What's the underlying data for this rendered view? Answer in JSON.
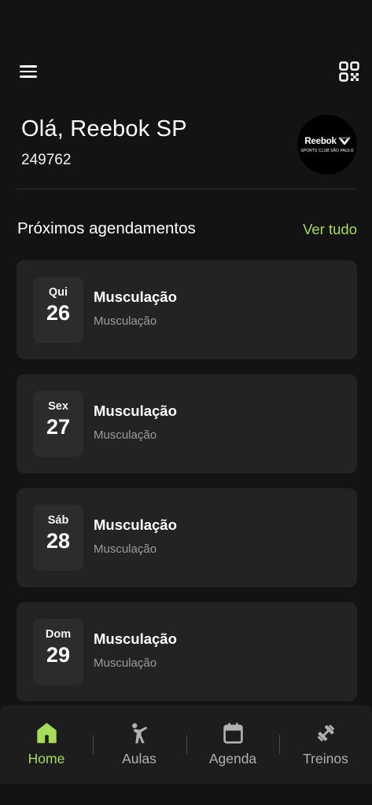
{
  "header": {
    "greeting": "Olá, Reebok SP",
    "member_id": "249762",
    "logo": {
      "brand": "Reebok",
      "subtitle": "SPORTS CLUB SÃO PAULO"
    },
    "icons": {
      "menu": "menu-icon",
      "qr": "qr-code-icon"
    }
  },
  "section": {
    "title": "Próximos agendamentos",
    "see_all": "Ver tudo"
  },
  "appointments": [
    {
      "day": "Qui",
      "date": "26",
      "title": "Musculação",
      "subtitle": "Musculação"
    },
    {
      "day": "Sex",
      "date": "27",
      "title": "Musculação",
      "subtitle": "Musculação"
    },
    {
      "day": "Sáb",
      "date": "28",
      "title": "Musculação",
      "subtitle": "Musculação"
    },
    {
      "day": "Dom",
      "date": "29",
      "title": "Musculação",
      "subtitle": "Musculação"
    }
  ],
  "nav": {
    "items": [
      {
        "label": "Home",
        "icon": "home-icon",
        "active": true
      },
      {
        "label": "Aulas",
        "icon": "person-exercise-icon",
        "active": false
      },
      {
        "label": "Agenda",
        "icon": "calendar-icon",
        "active": false
      },
      {
        "label": "Treinos",
        "icon": "dumbbell-icon",
        "active": false
      }
    ]
  },
  "colors": {
    "background": "#131313",
    "card": "#232323",
    "date_box": "#2c2c2c",
    "accent": "#a6dc57",
    "muted_text": "#9c9c9c",
    "nav_background": "#1d1d1d"
  }
}
